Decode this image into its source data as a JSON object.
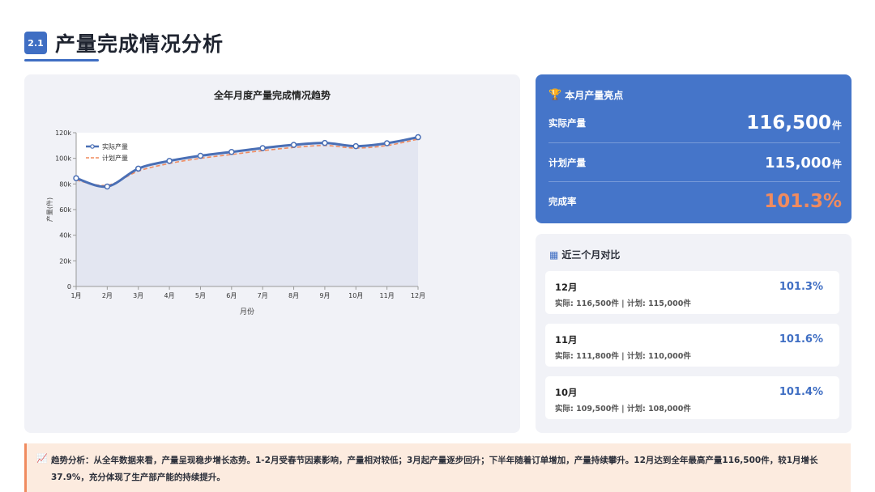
{
  "header": {
    "badge": "2.1",
    "title": "产量完成情况分析"
  },
  "chart_data": {
    "type": "line",
    "title": "全年月度产量完成情况趋势",
    "xlabel": "月份",
    "ylabel": "产量(件)",
    "categories": [
      "1月",
      "2月",
      "3月",
      "4月",
      "5月",
      "6月",
      "7月",
      "8月",
      "9月",
      "10月",
      "11月",
      "12月"
    ],
    "ylim": [
      0,
      120000
    ],
    "yticks": [
      0,
      20000,
      40000,
      60000,
      80000,
      100000,
      120000
    ],
    "ytick_labels": [
      "0",
      "20k",
      "40k",
      "60k",
      "80k",
      "100k",
      "120k"
    ],
    "legend_position": "top-left",
    "series": [
      {
        "name": "实际产量",
        "color": "#4a6fb5",
        "style": "solid-markers",
        "values": [
          84500,
          78000,
          92000,
          98000,
          102000,
          105000,
          108000,
          110500,
          112000,
          109500,
          111800,
          116500
        ]
      },
      {
        "name": "计划产量",
        "color": "#f08b5f",
        "style": "dashed",
        "values": [
          83000,
          79000,
          90000,
          96000,
          100000,
          103000,
          106000,
          108500,
          110000,
          108000,
          110000,
          115000
        ]
      }
    ]
  },
  "highlight": {
    "title": "本月产量亮点",
    "icon": "trophy-icon",
    "actual_label": "实际产量",
    "actual_value": "116,500",
    "actual_unit": "件",
    "plan_label": "计划产量",
    "plan_value": "115,000",
    "plan_unit": "件",
    "rate_label": "完成率",
    "rate_value": "101.3%"
  },
  "compare": {
    "title": "近三个月对比",
    "icon": "calendar-icon",
    "items": [
      {
        "month": "12月",
        "detail": "实际: 116,500件 | 计划: 115,000件",
        "pct": "101.3%"
      },
      {
        "month": "11月",
        "detail": "实际: 111,800件 | 计划: 110,000件",
        "pct": "101.6%"
      },
      {
        "month": "10月",
        "detail": "实际: 109,500件 | 计划: 108,000件",
        "pct": "101.4%"
      }
    ]
  },
  "note": {
    "icon": "trend-chart-icon",
    "text": "趋势分析：从全年数据来看，产量呈现稳步增长态势。1-2月受春节因素影响，产量相对较低；3月起产量逐步回升；下半年随着订单增加，产量持续攀升。12月达到全年最高产量116,500件，较1月增长37.9%，充分体现了生产部产能的持续提升。"
  }
}
